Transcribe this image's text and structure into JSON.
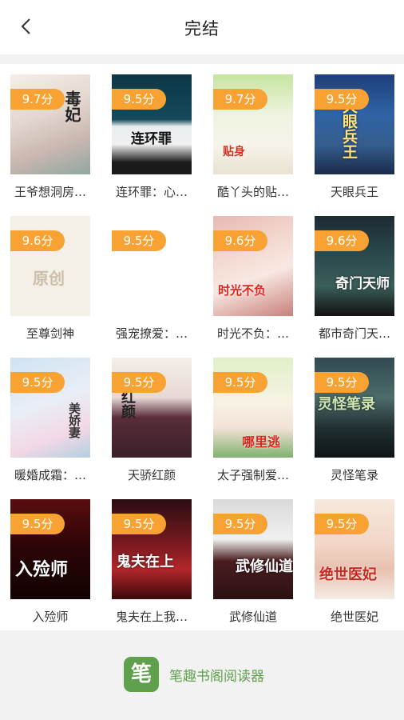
{
  "header": {
    "title": "完结",
    "back_icon": "chevron-left-icon"
  },
  "books": [
    {
      "title": "王爷想洞房…",
      "rating": "9.7分",
      "cover_text": "毒妃"
    },
    {
      "title": "连环罪：心…",
      "rating": "9.5分",
      "cover_text": "连环罪"
    },
    {
      "title": "酷丫头的贴…",
      "rating": "9.7分",
      "cover_text": "贴身"
    },
    {
      "title": "天眼兵王",
      "rating": "9.5分",
      "cover_text": "天眼兵王"
    },
    {
      "title": "至尊剑神",
      "rating": "9.6分",
      "cover_text": "原创"
    },
    {
      "title": "强宠撩爱：…",
      "rating": "9.5分",
      "cover_text": ""
    },
    {
      "title": "时光不负：…",
      "rating": "9.6分",
      "cover_text": "时光不负"
    },
    {
      "title": "都市奇门天…",
      "rating": "9.6分",
      "cover_text": "奇门天师"
    },
    {
      "title": "暖婚成霜：…",
      "rating": "9.5分",
      "cover_text": "美娇妻"
    },
    {
      "title": "天骄红颜",
      "rating": "9.5分",
      "cover_text": "红颜"
    },
    {
      "title": "太子强制爱…",
      "rating": "9.5分",
      "cover_text": "哪里逃"
    },
    {
      "title": "灵怪笔录",
      "rating": "9.5分",
      "cover_text": "灵怪笔录"
    },
    {
      "title": "入殓师",
      "rating": "9.5分",
      "cover_text": "入殓师"
    },
    {
      "title": "鬼夫在上我…",
      "rating": "9.5分",
      "cover_text": "鬼夫在上"
    },
    {
      "title": "武修仙道",
      "rating": "9.5分",
      "cover_text": "武修仙道"
    },
    {
      "title": "绝世医妃",
      "rating": "9.5分",
      "cover_text": "绝世医妃"
    }
  ],
  "footer": {
    "logo_char": "笔",
    "app_name": "笔趣书阁阅读器"
  },
  "colors": {
    "badge": "#f7a233",
    "brand": "#5ea04b"
  }
}
